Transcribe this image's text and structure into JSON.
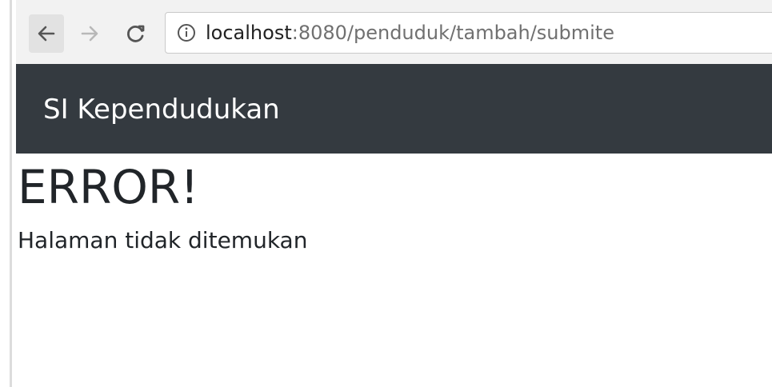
{
  "browser": {
    "url_host": "localhost",
    "url_path": ":8080/penduduk/tambah/submite",
    "icons": {
      "back": "back-arrow-icon",
      "forward": "forward-arrow-icon",
      "reload": "reload-icon",
      "info": "info-icon"
    }
  },
  "navbar": {
    "brand": "SI Kependudukan",
    "background": "#343a40"
  },
  "content": {
    "title": "ERROR!",
    "message": "Halaman tidak ditemukan"
  }
}
